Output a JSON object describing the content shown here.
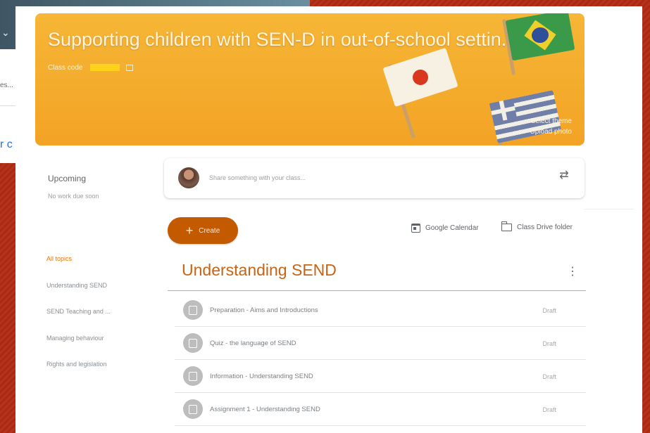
{
  "background_window": {
    "fragment_text": "es...",
    "link_fragment": "r c"
  },
  "banner": {
    "title": "Supporting children with SEN-D in out-of-school settin...",
    "class_code_label": "Class code",
    "select_theme": "Select theme",
    "upload_photo": "Upload photo",
    "color": "#f5ae2e"
  },
  "upcoming": {
    "title": "Upcoming",
    "empty": "No work due soon"
  },
  "topics": [
    {
      "label": "All topics",
      "active": true
    },
    {
      "label": "Understanding SEND"
    },
    {
      "label": "SEND Teaching and ..."
    },
    {
      "label": "Managing behaviour"
    },
    {
      "label": "Rights and legislation"
    }
  ],
  "share": {
    "placeholder": "Share something with your class..."
  },
  "toolbar": {
    "create_label": "Create",
    "calendar_label": "Google Calendar",
    "drive_label": "Class Drive folder"
  },
  "section": {
    "title": "Understanding SEND",
    "items": [
      {
        "title": "Preparation - Aims and Introductions",
        "status": "Draft",
        "icon": "assignment-icon"
      },
      {
        "title": "Quiz - the language of SEND",
        "status": "Draft",
        "icon": "quiz-icon"
      },
      {
        "title": "Information - Understanding SEND",
        "status": "Draft",
        "icon": "material-icon"
      },
      {
        "title": "Assignment 1 - Understanding SEND",
        "status": "Draft",
        "icon": "assignment-icon"
      }
    ]
  },
  "colors": {
    "accent": "#e37400",
    "create_button": "#c45a00",
    "section_title": "#c86414"
  }
}
